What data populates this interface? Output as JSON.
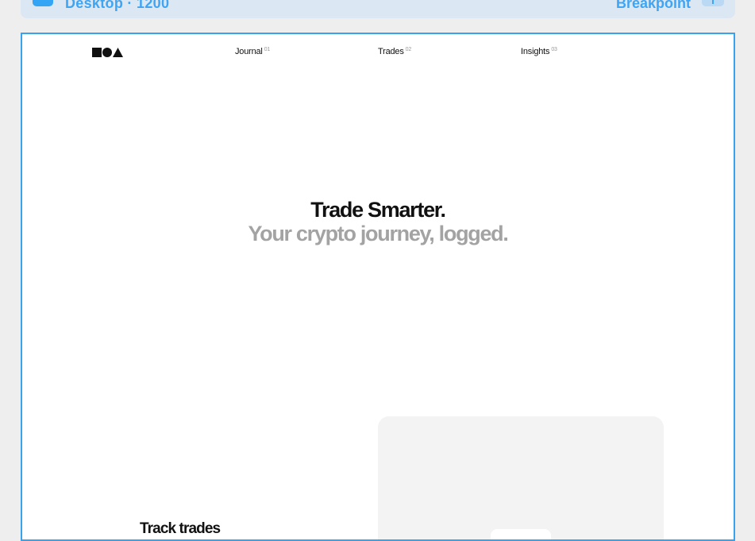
{
  "toolbar": {
    "title": "Desktop · 1200",
    "breakpoint_label": "Breakpoint",
    "colors": {
      "accent": "#3ea4f4",
      "background": "#dbe8f3"
    }
  },
  "site": {
    "logo_name": "moa-logo",
    "nav": [
      {
        "label": "Journal",
        "index": "01"
      },
      {
        "label": "Trades",
        "index": "02"
      },
      {
        "label": "Insights",
        "index": "03"
      }
    ],
    "hero": {
      "line1": "Trade Smarter.",
      "line2": "Your crypto journey, logged."
    },
    "section_title": "Track trades"
  },
  "colors": {
    "frame_border": "#37a3ee",
    "text": "#111111",
    "muted": "#a3a3a3",
    "card": "#f3f3f3"
  }
}
